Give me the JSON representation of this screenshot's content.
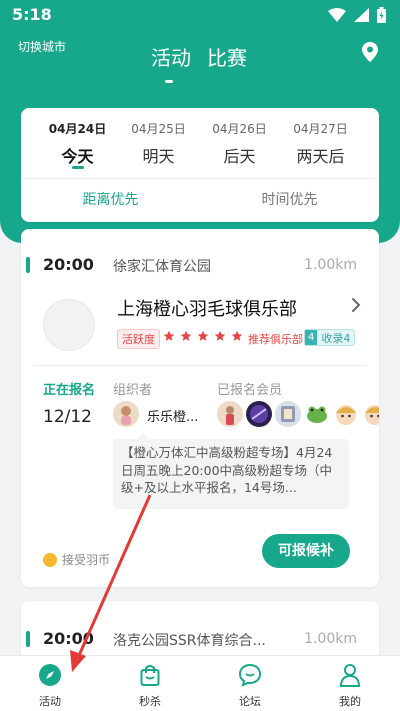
{
  "status": {
    "time": "5:18"
  },
  "header": {
    "city_switch": "切换城市",
    "tabs": [
      {
        "label": "活动"
      },
      {
        "label": "比赛"
      }
    ]
  },
  "dates": [
    {
      "date": "04月24日",
      "label": "今天"
    },
    {
      "date": "04月25日",
      "label": "明天"
    },
    {
      "date": "04月26日",
      "label": "后天"
    },
    {
      "date": "04月27日",
      "label": "两天后"
    }
  ],
  "sort": [
    {
      "label": "距离优先"
    },
    {
      "label": "时间优先"
    }
  ],
  "events": [
    {
      "time": "20:00",
      "venue": "徐家汇体育公园",
      "distance": "1.00km",
      "club": "上海橙心羽毛球俱乐部",
      "activity_tag": "活跃度",
      "stars": 5,
      "recommend": "推荐俱乐部",
      "collect_num": "4",
      "collect_text": "收录4",
      "reg_status": "正在报名",
      "reg_count": "12/12",
      "org_label": "组织者",
      "org_name": "乐乐橙...",
      "members_label": "已报名会员",
      "description": "【橙心万体汇中高级粉超专场】4月24日周五晚上20:00中高级粉超专场（中级+及以上水平报名，14号场...",
      "badge": "接受羽币",
      "button": "可报候补"
    },
    {
      "time": "20:00",
      "venue": "洛克公园SSR体育综合...",
      "distance": "1.00km"
    }
  ],
  "nav": [
    {
      "label": "活动",
      "icon": "compass-icon"
    },
    {
      "label": "秒杀",
      "icon": "shopping-bag-icon"
    },
    {
      "label": "论坛",
      "icon": "chat-bubble-icon"
    },
    {
      "label": "我的",
      "icon": "person-icon"
    }
  ],
  "colors": {
    "brand": "#17a88c",
    "star": "#e64545",
    "annotation_arrow": "#e53935"
  }
}
